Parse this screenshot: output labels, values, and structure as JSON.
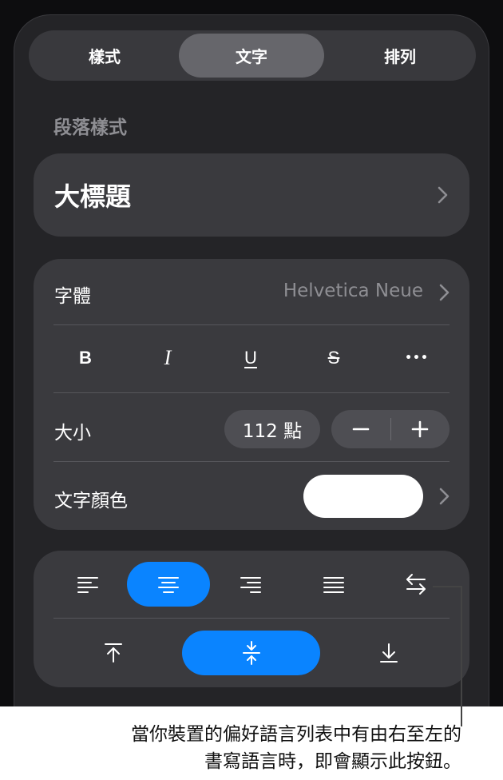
{
  "tabs": [
    {
      "label": "樣式",
      "active": false
    },
    {
      "label": "文字",
      "active": true
    },
    {
      "label": "排列",
      "active": false
    }
  ],
  "paragraph_section": {
    "title": "段落樣式",
    "value": "大標題"
  },
  "font": {
    "label": "字體",
    "value": "Helvetica Neue"
  },
  "format_buttons": {
    "bold": "B",
    "italic": "I",
    "underline": "U",
    "strikethrough": "S",
    "more": "•••"
  },
  "size": {
    "label": "大小",
    "value": "112 點",
    "decrease": "−",
    "increase": "+"
  },
  "text_color": {
    "label": "文字顏色",
    "swatch": "#ffffff"
  },
  "alignment": {
    "selected": "center",
    "rtl_button": "right-to-left-icon"
  },
  "vertical_alignment": {
    "selected": "middle"
  },
  "callout": {
    "line1": "當你裝置的偏好語言列表中有由右至左的",
    "line2": "書寫語言時，即會顯示此按鈕。"
  },
  "colors": {
    "accent": "#0a84ff",
    "panel": "#242427",
    "card": "#3a3a3e",
    "muted_text": "#8e8e93"
  }
}
